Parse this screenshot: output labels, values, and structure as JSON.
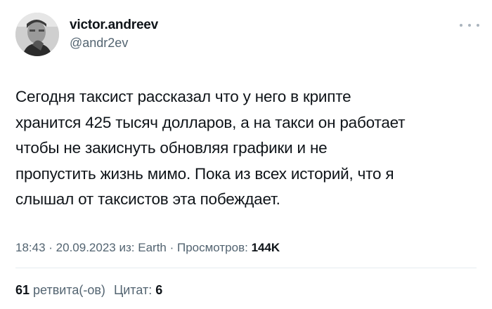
{
  "user": {
    "display_name": "victor.andreev",
    "handle": "@andr2ev"
  },
  "tweet": {
    "lines": [
      "Сегодня таксист рассказал что у него в крипте",
      "хранится 425 тысяч долларов, а на такси он работает",
      "чтобы не закиснуть обновляя графики и не",
      "пропустить жизнь мимо. Пока из всех историй, что я",
      "слышал от таксистов эта побеждает."
    ]
  },
  "meta": {
    "time": "18:43",
    "separator": " · ",
    "date": "20.09.2023",
    "source_prefix": "из: ",
    "source": "Earth",
    "views_label": "Просмотров: ",
    "views_count": "144K"
  },
  "stats": {
    "retweets_count": "61",
    "retweets_label": " ретвита(-ов)",
    "quotes_label": "Цитат: ",
    "quotes_count": "6"
  },
  "icons": {
    "more": "more-icon"
  },
  "colors": {
    "text": "#0f1419",
    "secondary": "#536471"
  }
}
